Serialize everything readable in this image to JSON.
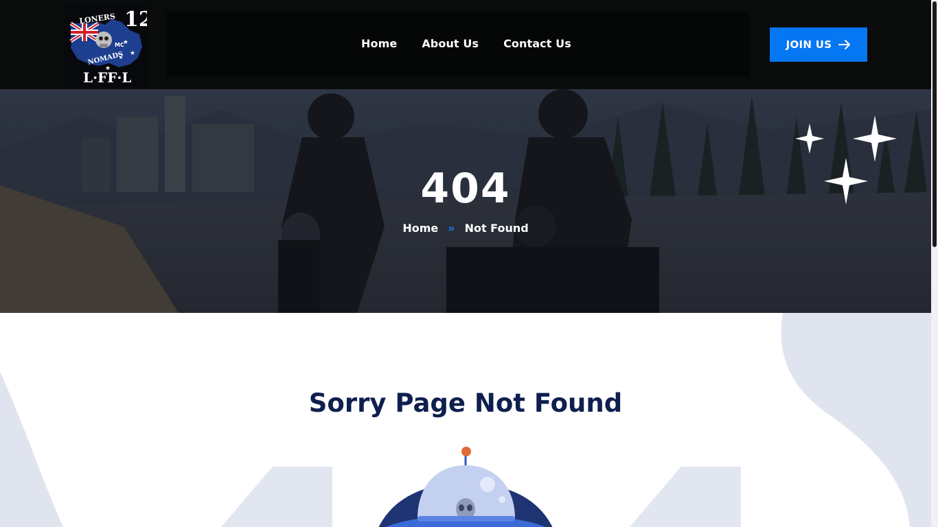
{
  "header": {
    "logo": {
      "top_text": "LONERS",
      "number": "12",
      "middle_text": "MC",
      "bottom_text": "NOMADS",
      "base_text": "L·FF·L"
    },
    "nav": [
      {
        "label": "Home"
      },
      {
        "label": "About Us"
      },
      {
        "label": "Contact Us"
      }
    ],
    "join_button": {
      "label": "JOIN US"
    }
  },
  "hero": {
    "title": "404",
    "breadcrumb": {
      "home": "Home",
      "separator": "»",
      "current": "Not Found"
    }
  },
  "content": {
    "title": "Sorry Page Not Found"
  },
  "colors": {
    "accent": "#0677f2",
    "heading": "#0f1f4f",
    "header_bg": "#0a0b0b",
    "shape": "#e0e4ee"
  },
  "icons": [
    "arrow-right-icon",
    "double-chevron-icon",
    "sparkle-icon",
    "ufo-illustration"
  ]
}
